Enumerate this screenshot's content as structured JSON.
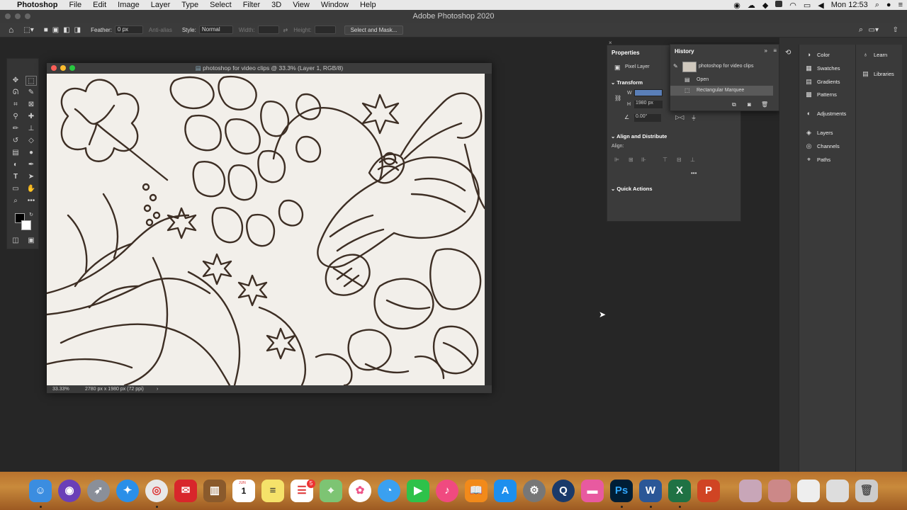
{
  "menubar": {
    "app": "Photoshop",
    "items": [
      "File",
      "Edit",
      "Image",
      "Layer",
      "Type",
      "Select",
      "Filter",
      "3D",
      "View",
      "Window",
      "Help"
    ],
    "clock": "Mon 12:53"
  },
  "window_title": "Adobe Photoshop 2020",
  "options_bar": {
    "feather_label": "Feather:",
    "feather_value": "0 px",
    "antialias_label": "Anti-alias",
    "style_label": "Style:",
    "style_value": "Normal",
    "width_label": "Width:",
    "height_label": "Height:",
    "select_mask_label": "Select and Mask..."
  },
  "document": {
    "title": "photoshop for video clips @ 33.3% (Layer 1, RGB/8)",
    "zoom": "33.33%",
    "dimensions": "2780 px x 1980 px (72 ppi)"
  },
  "properties": {
    "tab": "Properties",
    "layer_type": "Pixel Layer",
    "transform_title": "Transform",
    "w_label": "W",
    "h_label": "H",
    "h_value": "1980 px",
    "angle_value": "0.00°",
    "align_title": "Align and Distribute",
    "align_label": "Align:",
    "quick_actions_title": "Quick Actions"
  },
  "history": {
    "tab": "History",
    "snapshot": "photoshop for video clips",
    "items": [
      "Open",
      "Rectangular Marquee"
    ]
  },
  "panels_a": [
    "Color",
    "Swatches",
    "Gradients",
    "Patterns",
    "Adjustments",
    "Layers",
    "Channels",
    "Paths"
  ],
  "panels_b": [
    "Learn",
    "Libraries"
  ],
  "dock_badge": "5",
  "calendar": {
    "month": "JUN",
    "day": "1"
  }
}
